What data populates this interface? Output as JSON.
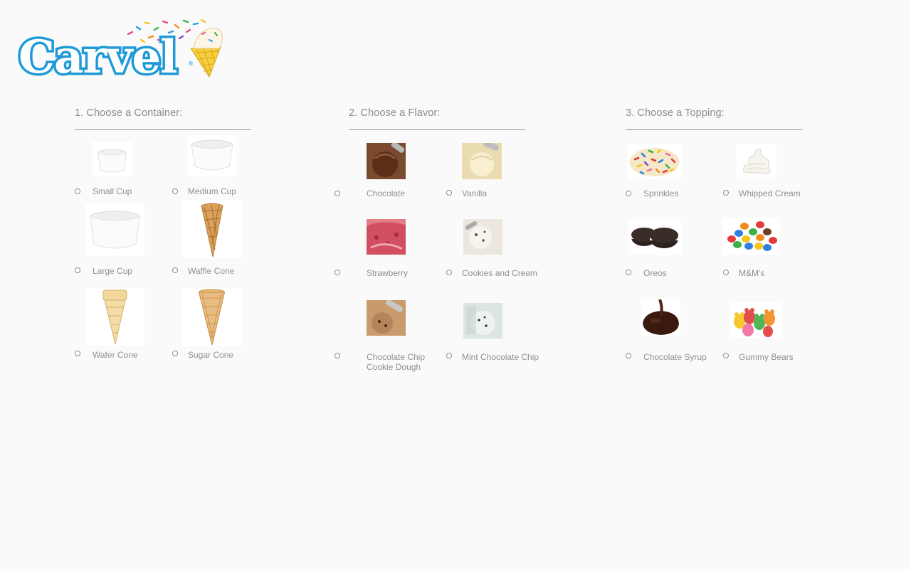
{
  "brand": {
    "name": "Carvel"
  },
  "sections": {
    "container": {
      "title": "1. Choose a Container:",
      "options": [
        "Small Cup",
        "Medium Cup",
        "Large Cup",
        "Waffle Cone",
        "Wafer Cone",
        "Sugar Cone"
      ]
    },
    "flavor": {
      "title": "2. Choose a Flavor:",
      "options": [
        "Chocolate",
        "Vanilla",
        "Strawberry",
        "Cookies and Cream",
        "Chocolate Chip Cookie Dough",
        "Mint Chocolate Chip"
      ]
    },
    "topping": {
      "title": "3. Choose a Topping:",
      "options": [
        "Sprinkles",
        "Whipped Cream",
        "Oreos",
        "M&M's",
        "Chocolate Syrup",
        "Gummy Bears"
      ]
    }
  },
  "colors": {
    "brand_blue": "#1e9ad8",
    "cone_yellow": "#f5cf3c",
    "page_bg": "#fafafa",
    "text_gray": "#8f8f8f"
  }
}
